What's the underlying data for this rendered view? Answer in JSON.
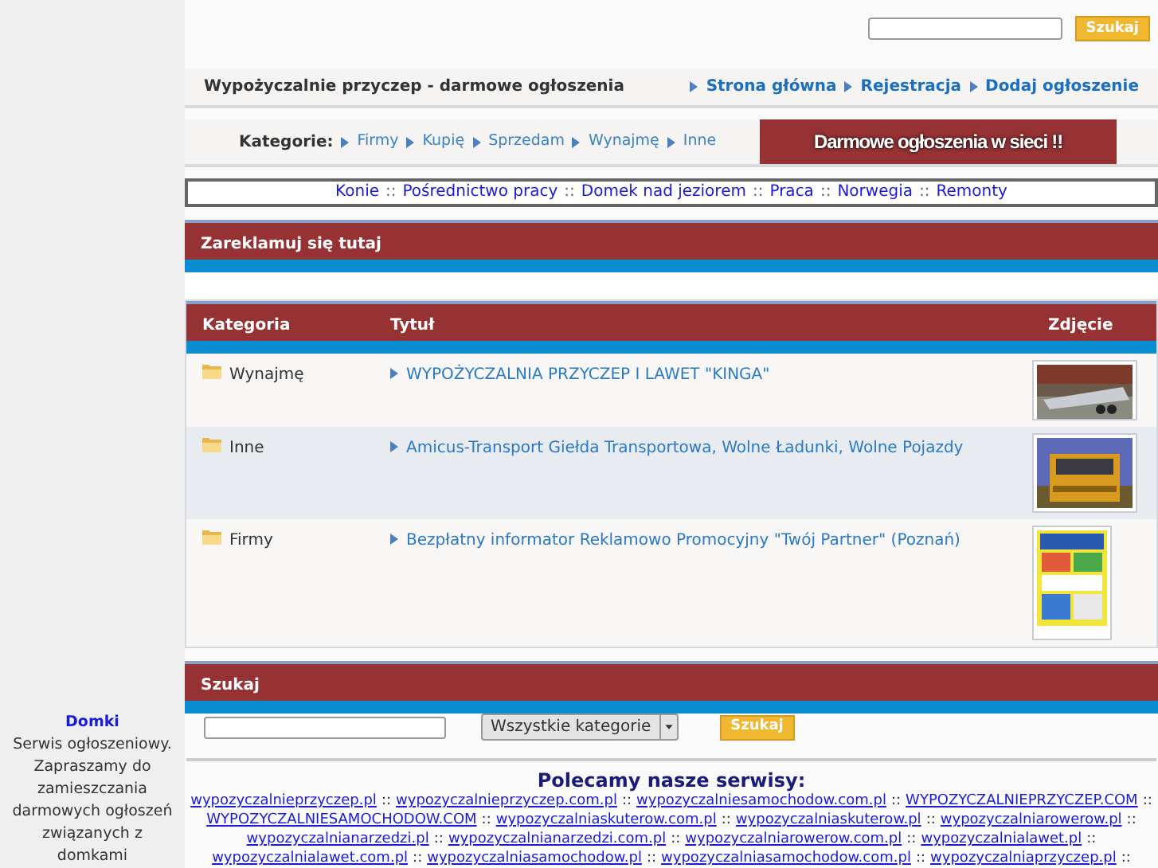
{
  "sidebar": {
    "title": "Domki",
    "text": "Serwis ogłoszeniowy. Zapraszamy do zamieszczania darmowych ogłoszeń związanych z domkami"
  },
  "top_search": {
    "button": "Szukaj"
  },
  "title_bar": {
    "title": "Wypożyczalnie przyczep - darmowe ogłoszenia",
    "links": [
      "Strona główna",
      "Rejestracja",
      "Dodaj ogłoszenie"
    ]
  },
  "category_bar": {
    "label": "Kategorie:",
    "links": [
      "Firmy",
      "Kupię",
      "Sprzedam",
      "Wynajmę",
      "Inne"
    ],
    "banner": "Darmowe ogłoszenia w sieci !!"
  },
  "topic_links": {
    "separator": "::",
    "links": [
      "Konie",
      "Pośrednictwo pracy",
      "Domek nad jeziorem",
      "Praca",
      "Norwegia",
      "Remonty"
    ]
  },
  "ad_panel": {
    "title": "Zareklamuj się tutaj"
  },
  "table": {
    "columns": [
      "Kategoria",
      "Tytuł",
      "Zdjęcie"
    ],
    "rows": [
      {
        "category": "Wynajmę",
        "title": "WYPOŻYCZALNIA PRZYCZEP I LAWET \"KINGA\"",
        "highlighted": false
      },
      {
        "category": "Inne",
        "title": "Amicus-Transport Giełda Transportowa, Wolne Ładunki, Wolne Pojazdy",
        "highlighted": true
      },
      {
        "category": "Firmy",
        "title": "Bezpłatny informator Reklamowo Promocyjny \"Twój Partner\" (Poznań)",
        "highlighted": false
      }
    ]
  },
  "search_panel": {
    "title": "Szukaj",
    "category_select": "Wszystkie kategorie",
    "button": "Szukaj"
  },
  "recommended": {
    "title": "Polecamy nasze serwisy:",
    "separator": "::",
    "lines": [
      [
        "wypozyczalnieprzyczep.pl",
        "wypozyczalnieprzyczep.com.pl",
        "wypozyczalniesamochodow.com.pl",
        "WYPOZYCZALNIEPRZYCZEP.COM"
      ],
      [
        "WYPOZYCZALNIESAMOCHODOW.COM",
        "wypozyczalniaskuterow.com.pl",
        "wypozyczalniaskuterow.pl",
        "wypozyczalniarowerow.pl"
      ],
      [
        "wypozyczalnianarzedzi.pl",
        "wypozyczalnianarzedzi.com.pl",
        "wypozyczalniarowerow.com.pl",
        "wypozyczalnialawet.pl"
      ],
      [
        "wypozyczalnialawet.com.pl",
        "wypozyczalniasamochodow.pl",
        "wypozyczalniasamochodow.com.pl",
        "wypozyczalniaprzyczep.pl"
      ]
    ]
  }
}
